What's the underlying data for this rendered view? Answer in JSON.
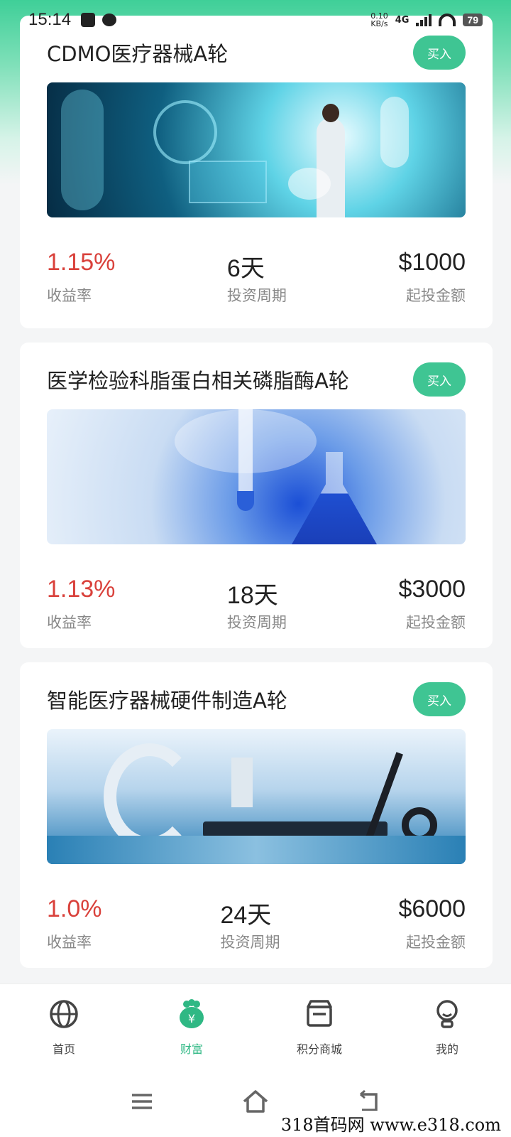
{
  "status_bar": {
    "time": "15:14",
    "net_speed": "0.10",
    "net_unit": "KB/s",
    "network": "4G",
    "battery": "79"
  },
  "products": [
    {
      "title": "CDMO医疗器械A轮",
      "buy_label": "买入",
      "rate": "1.15%",
      "rate_label": "收益率",
      "period": "6天",
      "period_label": "投资周期",
      "amount": "$1000",
      "amount_label": "起投金额",
      "image": "medical-technology-image"
    },
    {
      "title": "医学检验科脂蛋白相关磷脂酶A轮",
      "buy_label": "买入",
      "rate": "1.13%",
      "rate_label": "收益率",
      "period": "18天",
      "period_label": "投资周期",
      "amount": "$3000",
      "amount_label": "起投金额",
      "image": "laboratory-flask-image"
    },
    {
      "title": "智能医疗器械硬件制造A轮",
      "buy_label": "买入",
      "rate": "1.0%",
      "rate_label": "收益率",
      "period": "24天",
      "period_label": "投资周期",
      "amount": "$6000",
      "amount_label": "起投金额",
      "image": "operating-room-image"
    }
  ],
  "tabbar": {
    "items": [
      {
        "label": "首页",
        "icon": "globe-icon",
        "active": false
      },
      {
        "label": "财富",
        "icon": "money-bag-icon",
        "active": true
      },
      {
        "label": "积分商城",
        "icon": "store-icon",
        "active": false
      },
      {
        "label": "我的",
        "icon": "user-icon",
        "active": false
      }
    ]
  },
  "colors": {
    "accent": "#3fc593",
    "rate": "#d9413b",
    "active_tab": "#2fb884"
  },
  "watermark": "318首码网 www.e318.com"
}
